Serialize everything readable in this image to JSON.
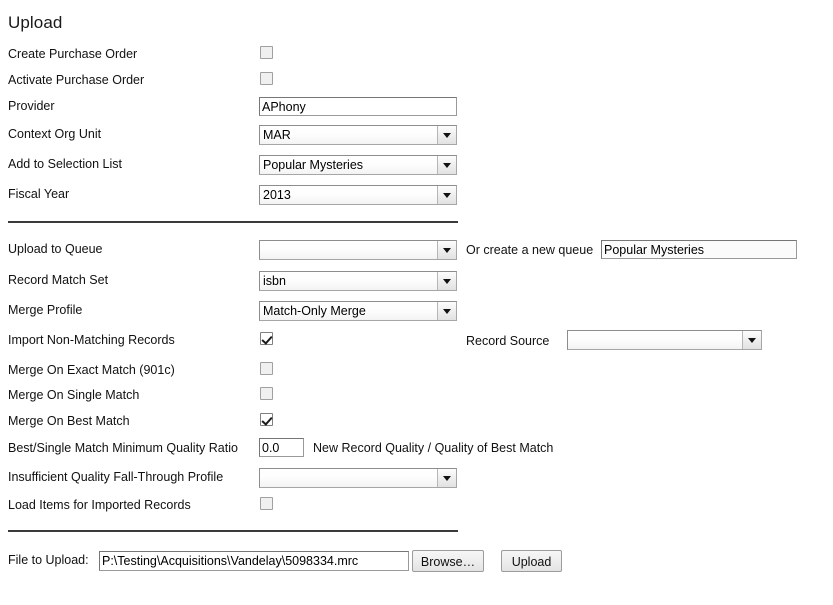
{
  "page": {
    "title": "Upload"
  },
  "section_one": {
    "rows": [
      {
        "label": "Create Purchase Order",
        "control": "checkbox",
        "checked": false
      },
      {
        "label": "Activate Purchase Order",
        "control": "checkbox",
        "checked": false
      },
      {
        "label": "Provider",
        "control": "text",
        "value": "APhony"
      },
      {
        "label": "Context Org Unit",
        "control": "select",
        "value": "MAR"
      },
      {
        "label": "Add to Selection List",
        "control": "select",
        "value": "Popular Mysteries"
      },
      {
        "label": "Fiscal Year",
        "control": "select",
        "value": "2013"
      }
    ]
  },
  "section_two": {
    "rows": [
      {
        "label": "Upload to Queue",
        "control": "select",
        "value": ""
      },
      {
        "label": "Record Match Set",
        "control": "select",
        "value": "isbn"
      },
      {
        "label": "Merge Profile",
        "control": "select",
        "value": "Match-Only Merge"
      },
      {
        "label": "Import Non-Matching Records",
        "control": "checkbox",
        "checked": true
      },
      {
        "label": "Merge On Exact Match (901c)",
        "control": "checkbox",
        "checked": false
      },
      {
        "label": "Merge On Single Match",
        "control": "checkbox",
        "checked": false
      },
      {
        "label": "Merge On Best Match",
        "control": "checkbox",
        "checked": true
      }
    ],
    "new_queue_label": "Or create a new queue",
    "new_queue_value": "Popular Mysteries",
    "record_source_label": "Record Source",
    "record_source_value": ""
  },
  "section_three": {
    "quality_ratio_label": "Best/Single Match Minimum Quality Ratio",
    "quality_ratio_value": "0.0",
    "quality_ratio_hint": "New Record Quality / Quality of Best Match",
    "fallthrough_label": "Insufficient Quality Fall-Through Profile",
    "fallthrough_value": "",
    "load_items_label": "Load Items for Imported Records",
    "load_items_checked": false
  },
  "footer": {
    "file_label": "File to Upload:",
    "file_value": "P:\\Testing\\Acquisitions\\Vandelay\\5098334.mrc",
    "browse_label": "Browse…",
    "upload_label": "Upload"
  }
}
